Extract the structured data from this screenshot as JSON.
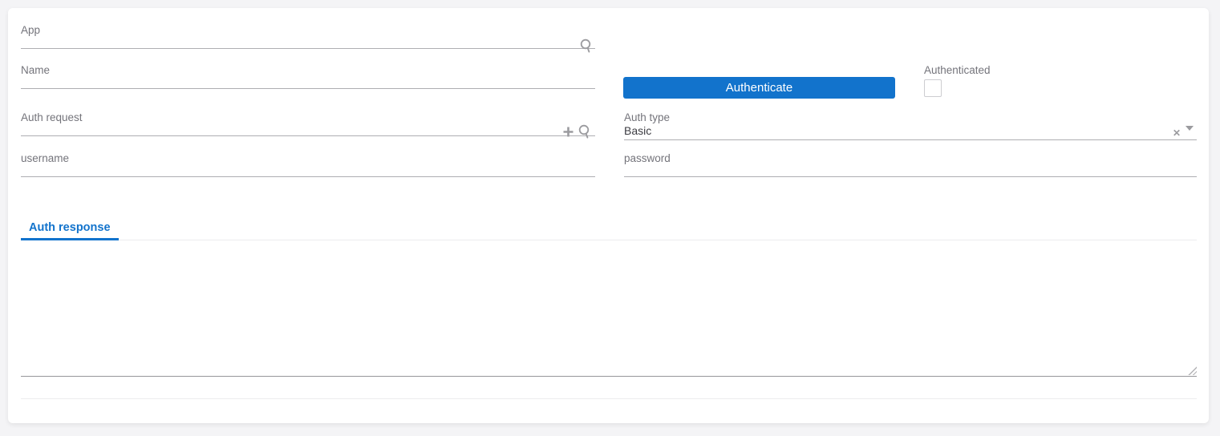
{
  "form": {
    "app": {
      "label": "App",
      "value": ""
    },
    "name": {
      "label": "Name",
      "value": ""
    },
    "auth_request": {
      "label": "Auth request",
      "value": ""
    },
    "auth_type": {
      "label": "Auth type",
      "value": "Basic"
    },
    "username": {
      "label": "username",
      "value": ""
    },
    "password": {
      "label": "password",
      "value": ""
    }
  },
  "actions": {
    "authenticate": "Authenticate"
  },
  "status": {
    "authenticated_label": "Authenticated",
    "authenticated_checked": false
  },
  "tabs": {
    "auth_response": "Auth response"
  },
  "response": {
    "value": ""
  },
  "icons": {
    "app_lookup": "search-icon",
    "auth_request_add": "plus-icon",
    "auth_request_lookup": "search-icon",
    "auth_type_clear": "x-clear-icon",
    "auth_type_open": "caret-down-icon",
    "response_resize": "resize-handle"
  },
  "colors": {
    "accent_blue": "#1273cc",
    "label_gray": "#74747b",
    "underline_gray": "#aeaeb2",
    "icon_gray": "#9b9b9f",
    "page_bg": "#f4f4f6",
    "card_bg": "#ffffff"
  }
}
